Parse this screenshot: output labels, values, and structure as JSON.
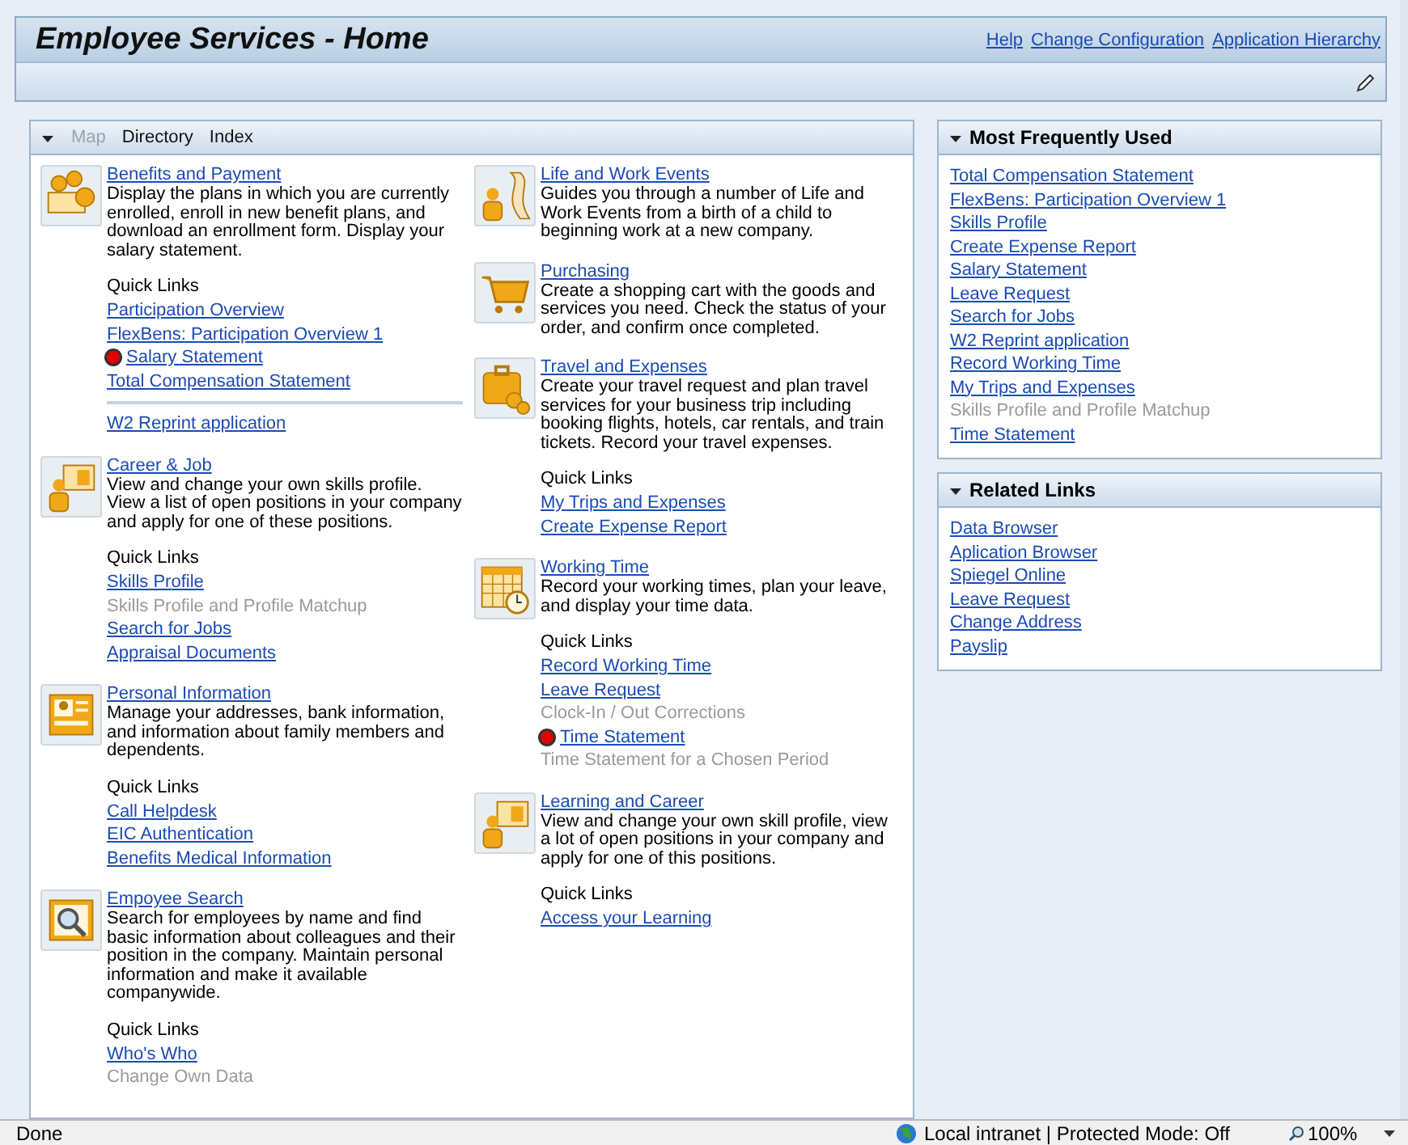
{
  "header": {
    "title": "Employee Services - Home",
    "links": [
      "Help",
      "Change Configuration",
      "Application Hierarchy"
    ]
  },
  "main_panel": {
    "tabs": [
      {
        "label": "Map",
        "disabled": true
      },
      {
        "label": "Directory",
        "disabled": false
      },
      {
        "label": "Index",
        "disabled": false
      }
    ],
    "columns": [
      [
        {
          "kind": "coins",
          "title": "Benefits and Payment",
          "description": "Display the plans in which you are currently enrolled, enroll in new benefit plans, and download an enrollment form. Display your salary statement.",
          "quick_links_label": "Quick Links",
          "links": [
            {
              "text": "Participation Overview",
              "kind": "link"
            },
            {
              "text": "FlexBens: Participation Overview 1",
              "kind": "link"
            },
            {
              "text": "Salary Statement",
              "kind": "alert"
            },
            {
              "text": "Total Compensation Statement",
              "kind": "link"
            }
          ],
          "extra_links": [
            {
              "text": "W2 Reprint application",
              "kind": "link"
            }
          ]
        },
        {
          "kind": "person-board",
          "title": "Career & Job",
          "description": "View and change your own skills profile. View a list of open positions in your company and apply for one of these positions.",
          "quick_links_label": "Quick Links",
          "links": [
            {
              "text": "Skills Profile",
              "kind": "link"
            },
            {
              "text": "Skills Profile and Profile Matchup",
              "kind": "disabled"
            },
            {
              "text": "Search for Jobs",
              "kind": "link"
            },
            {
              "text": "Appraisal Documents",
              "kind": "link"
            }
          ]
        },
        {
          "kind": "id-card",
          "title": "Personal Information",
          "description": "Manage your addresses, bank information, and information about family members and dependents.",
          "quick_links_label": "Quick Links",
          "links": [
            {
              "text": "Call Helpdesk",
              "kind": "link"
            },
            {
              "text": "EIC Authentication",
              "kind": "link"
            },
            {
              "text": "Benefits Medical Information",
              "kind": "link"
            }
          ]
        },
        {
          "kind": "search-card",
          "title": "Empoyee Search",
          "description": "Search for employees by name and find basic information about colleagues and their position in the company. Maintain personal information and make it available companywide.",
          "quick_links_label": "Quick Links",
          "links": [
            {
              "text": "Who's Who",
              "kind": "link"
            },
            {
              "text": "Change Own Data",
              "kind": "disabled"
            }
          ]
        }
      ],
      [
        {
          "kind": "person-road",
          "title": "Life and Work Events",
          "description": "Guides you through a number of Life and Work Events from a birth of a child to beginning work at a new company."
        },
        {
          "kind": "cart",
          "title": "Purchasing",
          "description": "Create a shopping cart with the goods and services you need. Check the status of your order, and confirm once completed."
        },
        {
          "kind": "suitcase",
          "title": "Travel and Expenses",
          "description": "Create your travel request and plan travel services for your business trip including booking flights, hotels, car rentals, and train tickets. Record your travel expenses.",
          "quick_links_label": "Quick Links",
          "links": [
            {
              "text": "My Trips and Expenses",
              "kind": "link"
            },
            {
              "text": "Create Expense Report",
              "kind": "link"
            }
          ]
        },
        {
          "kind": "calendar-clock",
          "title": "Working Time",
          "description": "Record your working times, plan your leave, and display your time data.",
          "quick_links_label": "Quick Links",
          "links": [
            {
              "text": "Record Working Time",
              "kind": "link"
            },
            {
              "text": "Leave Request",
              "kind": "link"
            },
            {
              "text": "Clock-In / Out Corrections",
              "kind": "disabled"
            },
            {
              "text": "Time Statement",
              "kind": "alert"
            },
            {
              "text": "Time Statement for a Chosen Period",
              "kind": "disabled"
            }
          ]
        },
        {
          "kind": "person-board",
          "title": "Learning and Career",
          "description": "View and change your own skill profile, view a lot of open positions in your company and apply for one of this positions.",
          "quick_links_label": "Quick Links",
          "links": [
            {
              "text": "Access your Learning",
              "kind": "link"
            }
          ]
        }
      ]
    ]
  },
  "side_panels": [
    {
      "title": "Most Frequently Used",
      "links": [
        {
          "text": "Total Compensation Statement",
          "kind": "link"
        },
        {
          "text": "FlexBens: Participation Overview 1",
          "kind": "link"
        },
        {
          "text": "Skills Profile",
          "kind": "link"
        },
        {
          "text": "Create Expense Report",
          "kind": "link"
        },
        {
          "text": "Salary Statement",
          "kind": "link"
        },
        {
          "text": "Leave Request",
          "kind": "link"
        },
        {
          "text": "Search for Jobs",
          "kind": "link"
        },
        {
          "text": "W2 Reprint application",
          "kind": "link"
        },
        {
          "text": "Record Working Time",
          "kind": "link"
        },
        {
          "text": "My Trips and Expenses",
          "kind": "link"
        },
        {
          "text": "Skills Profile and Profile Matchup",
          "kind": "disabled"
        },
        {
          "text": "Time Statement",
          "kind": "link"
        }
      ]
    },
    {
      "title": "Related Links",
      "links": [
        {
          "text": "Data Browser",
          "kind": "link"
        },
        {
          "text": "Aplication Browser",
          "kind": "link"
        },
        {
          "text": "Spiegel Online",
          "kind": "link"
        },
        {
          "text": "Leave Request",
          "kind": "link"
        },
        {
          "text": "Change Address",
          "kind": "link"
        },
        {
          "text": "Payslip",
          "kind": "link"
        }
      ]
    }
  ],
  "status_bar": {
    "status": "Done",
    "zone": "Local intranet | Protected Mode: Off",
    "zoom": "100%"
  }
}
